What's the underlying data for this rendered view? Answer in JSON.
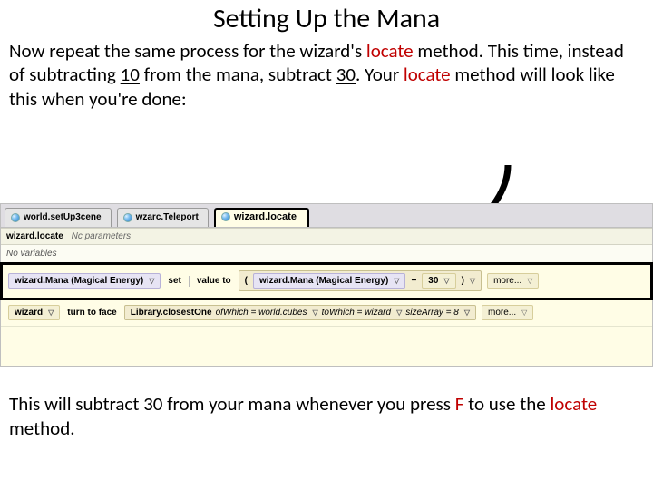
{
  "title": "Setting Up the Mana",
  "intro": {
    "t1": "Now repeat the same process for the wizard's ",
    "locate1": "locate",
    "t2": " method. This time, instead of subtracting ",
    "n10": "10",
    "t3": " from the mana, subtract ",
    "n30": "30",
    "t4": ". Your ",
    "locate2": "locate",
    "t5": " method will look like this when you're done:"
  },
  "tabs": {
    "t0": "world.setUp3cene",
    "t1": "wzarc.Teleport",
    "t2": "wizard.locate"
  },
  "sig": {
    "name": "wizard.locate",
    "np": "Nc parameters"
  },
  "novars": "No variables",
  "stmt1": {
    "var": "wizard.Mana (Magical Energy)",
    "set": "set",
    "valto": "value to",
    "lpar": "(",
    "minus": "−",
    "thirty": "30",
    "rpar": ")",
    "more": "more..."
  },
  "stmt2": {
    "obj": "wizard",
    "ttf": "turn to face",
    "lib": "Library.closestOne",
    "ofw": "ofWhich = world.cubes",
    "tow": "toWhich = wizard",
    "sza": "sizeArray = 8",
    "more": "more..."
  },
  "outro": {
    "t1": "This will subtract 30 from your mana whenever you press ",
    "F": "F",
    "t2": " to use the ",
    "locate": "locate",
    "t3": " method."
  }
}
